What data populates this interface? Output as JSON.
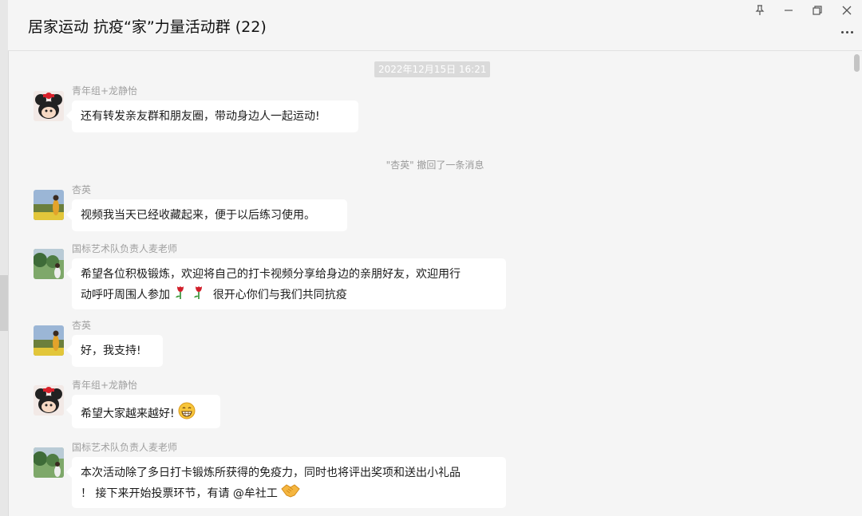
{
  "window": {
    "title": "居家运动 抗疫“家”力量活动群 (22)",
    "controls": [
      "pin-icon",
      "minimize-icon",
      "restore-icon",
      "close-icon"
    ]
  },
  "timestamp": "2022年12月15日 16:21",
  "notice": "\"杏英\" 撤回了一条消息",
  "messages": [
    {
      "sender": "青年组+龙静怡",
      "text": "还有转发亲友群和朋友圈，带动身边人一起运动!"
    },
    {
      "sender": "杏英",
      "text": "视频我当天已经收藏起来，便于以后练习使用。"
    },
    {
      "sender": "国标艺术队负责人麦老师",
      "line1": "希望各位积极锻炼，欢迎将自己的打卡视频分享给身边的亲朋好友，欢迎用行",
      "line2a": "动呼吁周围人参加",
      "line2b": "很开心你们与我们共同抗疫"
    },
    {
      "sender": "杏英",
      "text": "好，我支持!"
    },
    {
      "sender": "青年组+龙静怡",
      "text": "希望大家越来越好!"
    },
    {
      "sender": "国标艺术队负责人麦老师",
      "line1": "本次活动除了多日打卡锻炼所获得的免疫力，同时也将评出奖项和送出小礼品",
      "line2": "！ 接下来开始投票环节，有请 @牟社工"
    }
  ],
  "colors": {
    "background": "#f5f5f5",
    "bubble": "#ffffff",
    "meta_text": "#a0a0a0"
  }
}
